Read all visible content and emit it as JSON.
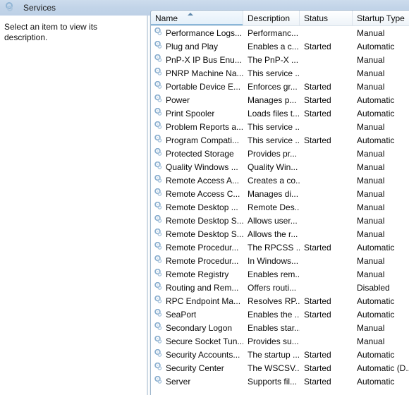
{
  "window": {
    "title": "Services",
    "icon": "services-gear-icon"
  },
  "left_pane": {
    "description": "Select an item to view its description."
  },
  "list": {
    "sort_column": "Name",
    "sort_direction": "ascending",
    "columns": [
      {
        "key": "name",
        "label": "Name"
      },
      {
        "key": "desc",
        "label": "Description"
      },
      {
        "key": "status",
        "label": "Status"
      },
      {
        "key": "startup",
        "label": "Startup Type"
      }
    ],
    "row_icon": "service-gear-icon",
    "rows": [
      {
        "name": "Performance Logs...",
        "desc": "Performanc...",
        "status": "",
        "startup": "Manual"
      },
      {
        "name": "Plug and Play",
        "desc": "Enables a c...",
        "status": "Started",
        "startup": "Automatic"
      },
      {
        "name": "PnP-X IP Bus Enu...",
        "desc": "The PnP-X ...",
        "status": "",
        "startup": "Manual"
      },
      {
        "name": "PNRP Machine Na...",
        "desc": "This service ...",
        "status": "",
        "startup": "Manual"
      },
      {
        "name": "Portable Device E...",
        "desc": "Enforces gr...",
        "status": "Started",
        "startup": "Manual"
      },
      {
        "name": "Power",
        "desc": "Manages p...",
        "status": "Started",
        "startup": "Automatic"
      },
      {
        "name": "Print Spooler",
        "desc": "Loads files t...",
        "status": "Started",
        "startup": "Automatic"
      },
      {
        "name": "Problem Reports a...",
        "desc": "This service ...",
        "status": "",
        "startup": "Manual"
      },
      {
        "name": "Program Compati...",
        "desc": "This service ...",
        "status": "Started",
        "startup": "Automatic"
      },
      {
        "name": "Protected Storage",
        "desc": "Provides pr...",
        "status": "",
        "startup": "Manual"
      },
      {
        "name": "Quality Windows ...",
        "desc": "Quality Win...",
        "status": "",
        "startup": "Manual"
      },
      {
        "name": "Remote Access A...",
        "desc": "Creates a co...",
        "status": "",
        "startup": "Manual"
      },
      {
        "name": "Remote Access C...",
        "desc": "Manages di...",
        "status": "",
        "startup": "Manual"
      },
      {
        "name": "Remote Desktop ...",
        "desc": "Remote Des...",
        "status": "",
        "startup": "Manual"
      },
      {
        "name": "Remote Desktop S...",
        "desc": "Allows user...",
        "status": "",
        "startup": "Manual"
      },
      {
        "name": "Remote Desktop S...",
        "desc": "Allows the r...",
        "status": "",
        "startup": "Manual"
      },
      {
        "name": "Remote Procedur...",
        "desc": "The RPCSS ...",
        "status": "Started",
        "startup": "Automatic"
      },
      {
        "name": "Remote Procedur...",
        "desc": "In Windows...",
        "status": "",
        "startup": "Manual"
      },
      {
        "name": "Remote Registry",
        "desc": "Enables rem...",
        "status": "",
        "startup": "Manual"
      },
      {
        "name": "Routing and Rem...",
        "desc": "Offers routi...",
        "status": "",
        "startup": "Disabled"
      },
      {
        "name": "RPC Endpoint Ma...",
        "desc": "Resolves RP...",
        "status": "Started",
        "startup": "Automatic"
      },
      {
        "name": "SeaPort",
        "desc": "Enables the ...",
        "status": "Started",
        "startup": "Automatic"
      },
      {
        "name": "Secondary Logon",
        "desc": "Enables star...",
        "status": "",
        "startup": "Manual"
      },
      {
        "name": "Secure Socket Tun...",
        "desc": "Provides su...",
        "status": "",
        "startup": "Manual"
      },
      {
        "name": "Security Accounts...",
        "desc": "The startup ...",
        "status": "Started",
        "startup": "Automatic"
      },
      {
        "name": "Security Center",
        "desc": "The WSCSV...",
        "status": "Started",
        "startup": "Automatic (D..."
      },
      {
        "name": "Server",
        "desc": "Supports fil...",
        "status": "Started",
        "startup": "Automatic"
      }
    ]
  },
  "colors": {
    "titlebar": "#c2d4e8",
    "sorted_column": "#e3eff9",
    "sort_underline": "#8ab6d8",
    "icon_blue": "#8fb4d4"
  }
}
